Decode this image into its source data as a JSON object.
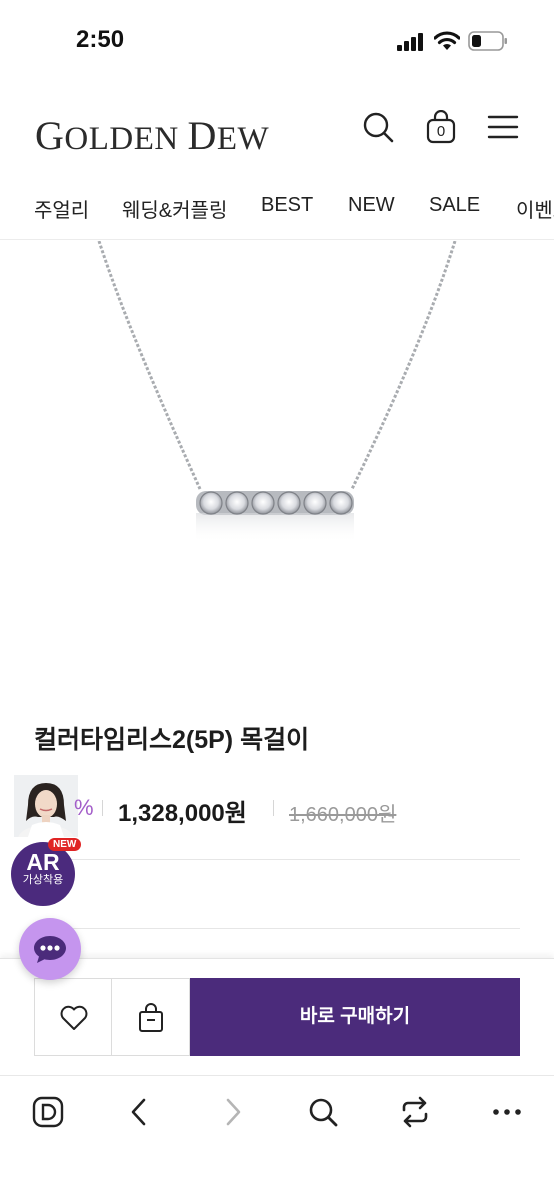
{
  "status_bar": {
    "time": "2:50"
  },
  "header": {
    "brand_initial_1": "G",
    "brand_rest_1": "OLDEN ",
    "brand_initial_2": "D",
    "brand_rest_2": "EW"
  },
  "categories": [
    "주얼리",
    "웨딩&커플링",
    "BEST",
    "NEW",
    "SALE",
    "이벤트"
  ],
  "product": {
    "title": "컬러타임리스2(5P) 목걸이",
    "discount_fragment": "%",
    "sale_price": "1,328,000원",
    "original_price": "1,660,000원"
  },
  "ar_badge": {
    "new_tag": "NEW",
    "title": "AR",
    "subtitle": "가상착용"
  },
  "buy_bar": {
    "buy_label": "바로 구매하기"
  },
  "cart": {
    "count": "0"
  },
  "colors": {
    "accent": "#4b2b7b",
    "chat": "#c595ee",
    "discount": "#a35ec9"
  },
  "icons": {
    "header": [
      "search-icon",
      "shopping-bag-icon",
      "menu-icon"
    ],
    "browser": [
      "browser-logo-icon",
      "back-icon",
      "forward-icon",
      "search-icon",
      "refresh-icon",
      "more-icon"
    ]
  }
}
